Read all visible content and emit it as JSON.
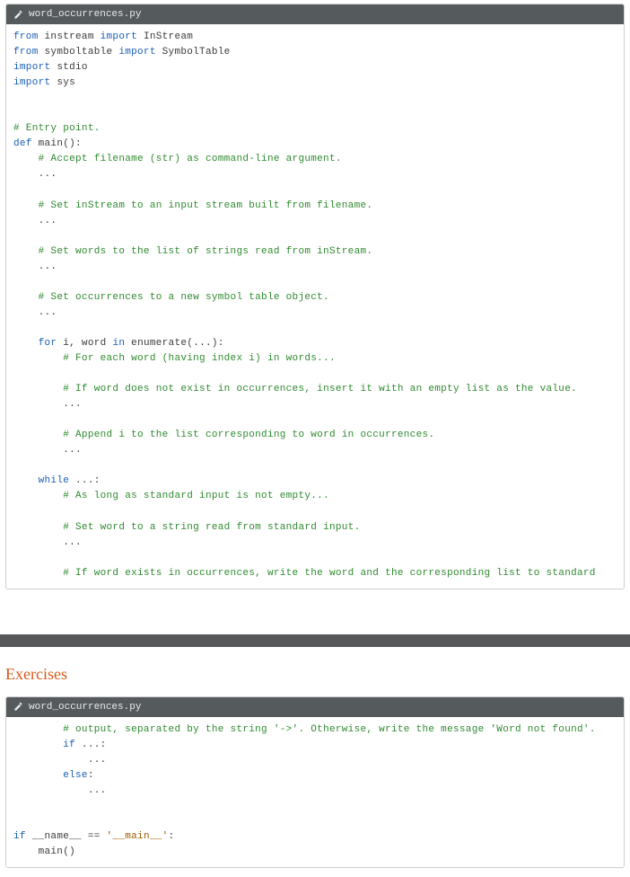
{
  "filename": "word_occurrences.py",
  "section_heading": "Exercises",
  "box1": {
    "lines": [
      [
        {
          "c": "kw",
          "t": "from"
        },
        {
          "c": "name",
          "t": " instream "
        },
        {
          "c": "kw",
          "t": "import"
        },
        {
          "c": "name",
          "t": " InStream"
        }
      ],
      [
        {
          "c": "kw",
          "t": "from"
        },
        {
          "c": "name",
          "t": " symboltable "
        },
        {
          "c": "kw",
          "t": "import"
        },
        {
          "c": "name",
          "t": " SymbolTable"
        }
      ],
      [
        {
          "c": "kw",
          "t": "import"
        },
        {
          "c": "name",
          "t": " stdio"
        }
      ],
      [
        {
          "c": "kw",
          "t": "import"
        },
        {
          "c": "name",
          "t": " sys"
        }
      ],
      [
        {
          "c": "name",
          "t": ""
        }
      ],
      [
        {
          "c": "name",
          "t": ""
        }
      ],
      [
        {
          "c": "cm",
          "t": "# Entry point."
        }
      ],
      [
        {
          "c": "kw",
          "t": "def"
        },
        {
          "c": "name",
          "t": " main():"
        }
      ],
      [
        {
          "c": "name",
          "t": "    "
        },
        {
          "c": "cm",
          "t": "# Accept filename (str) as command-line argument."
        }
      ],
      [
        {
          "c": "name",
          "t": "    ..."
        }
      ],
      [
        {
          "c": "name",
          "t": ""
        }
      ],
      [
        {
          "c": "name",
          "t": "    "
        },
        {
          "c": "cm",
          "t": "# Set inStream to an input stream built from filename."
        }
      ],
      [
        {
          "c": "name",
          "t": "    ..."
        }
      ],
      [
        {
          "c": "name",
          "t": ""
        }
      ],
      [
        {
          "c": "name",
          "t": "    "
        },
        {
          "c": "cm",
          "t": "# Set words to the list of strings read from inStream."
        }
      ],
      [
        {
          "c": "name",
          "t": "    ..."
        }
      ],
      [
        {
          "c": "name",
          "t": ""
        }
      ],
      [
        {
          "c": "name",
          "t": "    "
        },
        {
          "c": "cm",
          "t": "# Set occurrences to a new symbol table object."
        }
      ],
      [
        {
          "c": "name",
          "t": "    ..."
        }
      ],
      [
        {
          "c": "name",
          "t": ""
        }
      ],
      [
        {
          "c": "name",
          "t": "    "
        },
        {
          "c": "kw",
          "t": "for"
        },
        {
          "c": "name",
          "t": " i, word "
        },
        {
          "c": "kw",
          "t": "in"
        },
        {
          "c": "name",
          "t": " "
        },
        {
          "c": "fn",
          "t": "enumerate"
        },
        {
          "c": "name",
          "t": "(...):"
        }
      ],
      [
        {
          "c": "name",
          "t": "        "
        },
        {
          "c": "cm",
          "t": "# For each word (having index i) in words..."
        }
      ],
      [
        {
          "c": "name",
          "t": ""
        }
      ],
      [
        {
          "c": "name",
          "t": "        "
        },
        {
          "c": "cm",
          "t": "# If word does not exist in occurrences, insert it with an empty list as the value."
        }
      ],
      [
        {
          "c": "name",
          "t": "        ..."
        }
      ],
      [
        {
          "c": "name",
          "t": ""
        }
      ],
      [
        {
          "c": "name",
          "t": "        "
        },
        {
          "c": "cm",
          "t": "# Append i to the list corresponding to word in occurrences."
        }
      ],
      [
        {
          "c": "name",
          "t": "        ..."
        }
      ],
      [
        {
          "c": "name",
          "t": ""
        }
      ],
      [
        {
          "c": "name",
          "t": "    "
        },
        {
          "c": "kw",
          "t": "while"
        },
        {
          "c": "name",
          "t": " ...:"
        }
      ],
      [
        {
          "c": "name",
          "t": "        "
        },
        {
          "c": "cm",
          "t": "# As long as standard input is not empty..."
        }
      ],
      [
        {
          "c": "name",
          "t": ""
        }
      ],
      [
        {
          "c": "name",
          "t": "        "
        },
        {
          "c": "cm",
          "t": "# Set word to a string read from standard input."
        }
      ],
      [
        {
          "c": "name",
          "t": "        ..."
        }
      ],
      [
        {
          "c": "name",
          "t": ""
        }
      ],
      [
        {
          "c": "name",
          "t": "        "
        },
        {
          "c": "cm",
          "t": "# If word exists in occurrences, write the word and the corresponding list to standard"
        }
      ]
    ]
  },
  "box2": {
    "lines": [
      [
        {
          "c": "name",
          "t": "        "
        },
        {
          "c": "cm",
          "t": "# output, separated by the string '->'. Otherwise, write the message 'Word not found'."
        }
      ],
      [
        {
          "c": "name",
          "t": "        "
        },
        {
          "c": "kw",
          "t": "if"
        },
        {
          "c": "name",
          "t": " ...:"
        }
      ],
      [
        {
          "c": "name",
          "t": "            ..."
        }
      ],
      [
        {
          "c": "name",
          "t": "        "
        },
        {
          "c": "kw",
          "t": "else"
        },
        {
          "c": "name",
          "t": ":"
        }
      ],
      [
        {
          "c": "name",
          "t": "            ..."
        }
      ],
      [
        {
          "c": "name",
          "t": ""
        }
      ],
      [
        {
          "c": "name",
          "t": ""
        }
      ],
      [
        {
          "c": "kw",
          "t": "if"
        },
        {
          "c": "name",
          "t": " __name__ == "
        },
        {
          "c": "str",
          "t": "'__main__'"
        },
        {
          "c": "name",
          "t": ":"
        }
      ],
      [
        {
          "c": "name",
          "t": "    main()"
        }
      ]
    ]
  }
}
